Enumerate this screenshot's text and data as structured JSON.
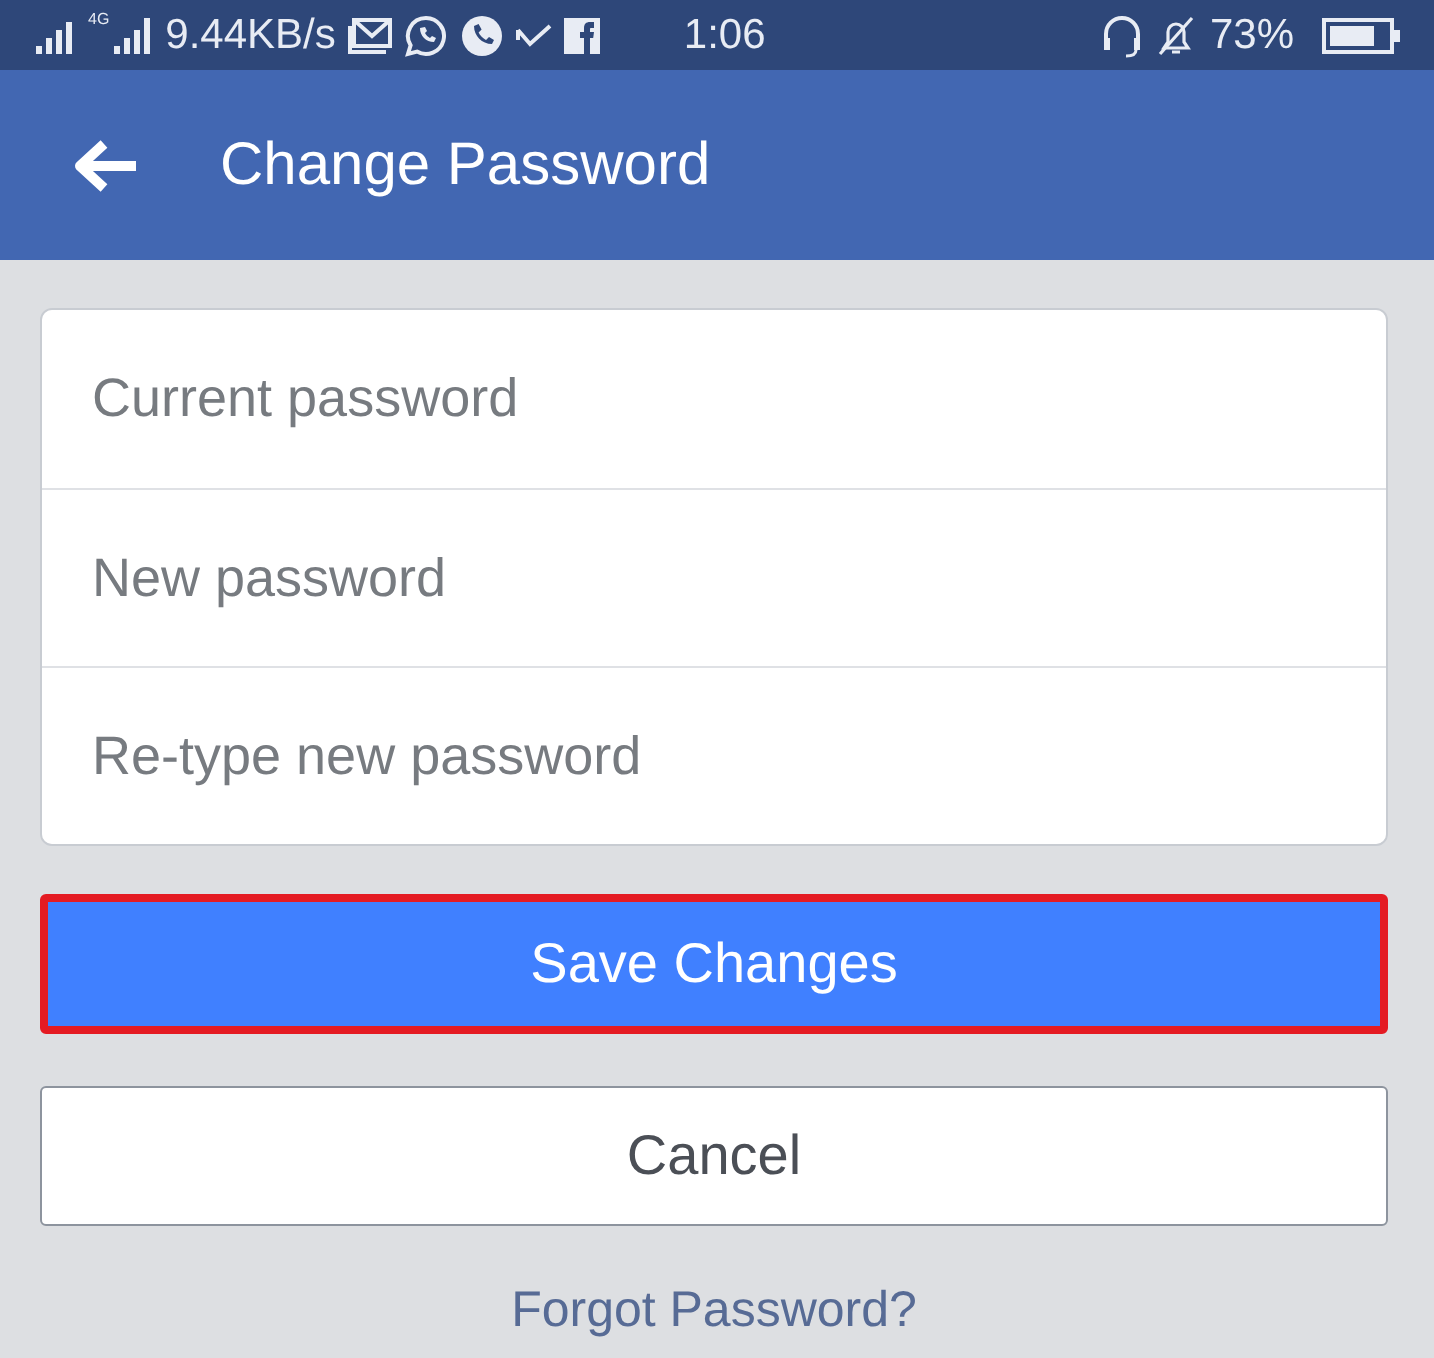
{
  "status_bar": {
    "network_type": "4G",
    "speed": "9.44KB/s",
    "time": "1:06",
    "battery": "73%"
  },
  "app_bar": {
    "title": "Change Password"
  },
  "fields": [
    {
      "placeholder": "Current password"
    },
    {
      "placeholder": "New password"
    },
    {
      "placeholder": "Re-type new password"
    }
  ],
  "buttons": [
    {
      "label": "Save Changes",
      "kind": "primary",
      "highlighted": true
    },
    {
      "label": "Cancel",
      "kind": "secondary",
      "highlighted": false
    }
  ],
  "link": "Forgot Password?"
}
